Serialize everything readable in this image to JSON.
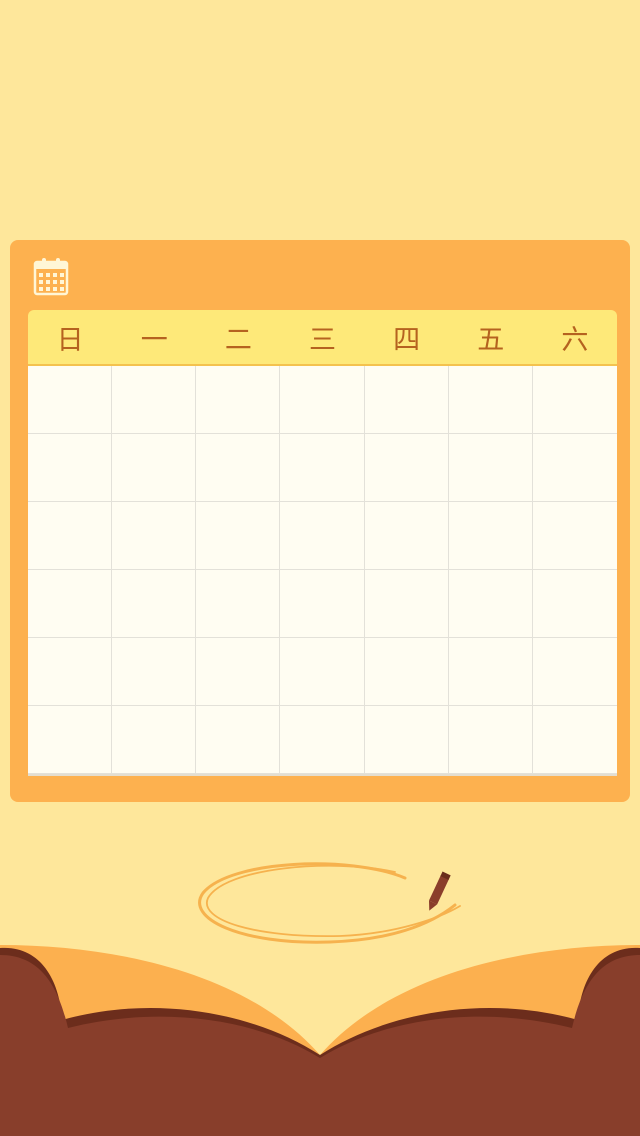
{
  "calendar": {
    "icon": "calendar-icon",
    "weekdays": [
      "日",
      "一",
      "二",
      "三",
      "四",
      "五",
      "六"
    ],
    "rows": 6,
    "columns": 7
  },
  "decorations": {
    "pencil": "pencil-icon",
    "book": "open-book-illustration",
    "scribble": "scribble-circle"
  },
  "colors": {
    "background": "#FEE79B",
    "card": "#FDB14F",
    "header": "#FEE979",
    "weekday_text": "#B5621F",
    "grid": "#FFFDF2",
    "book_brown": "#883E2B",
    "book_dark": "#6A2E1C"
  }
}
